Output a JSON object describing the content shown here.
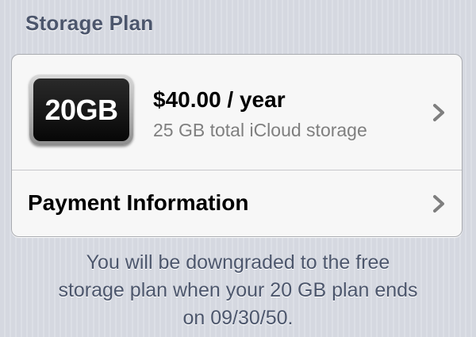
{
  "section": {
    "title": "Storage Plan"
  },
  "plan": {
    "badge_label": "20GB",
    "price": "$40.00 / year",
    "description": "25 GB total iCloud storage",
    "chevron_icon": "chevron-right-icon"
  },
  "payment": {
    "label": "Payment Information",
    "chevron_icon": "chevron-right-icon"
  },
  "footer": {
    "line1": "You will be downgraded to the free",
    "line2": "storage plan when your 20 GB plan ends",
    "line3": "on 09/30/50."
  },
  "colors": {
    "header_text": "#4c566c",
    "secondary_text": "#7f7f7f",
    "chevron": "#7f7f7f"
  }
}
